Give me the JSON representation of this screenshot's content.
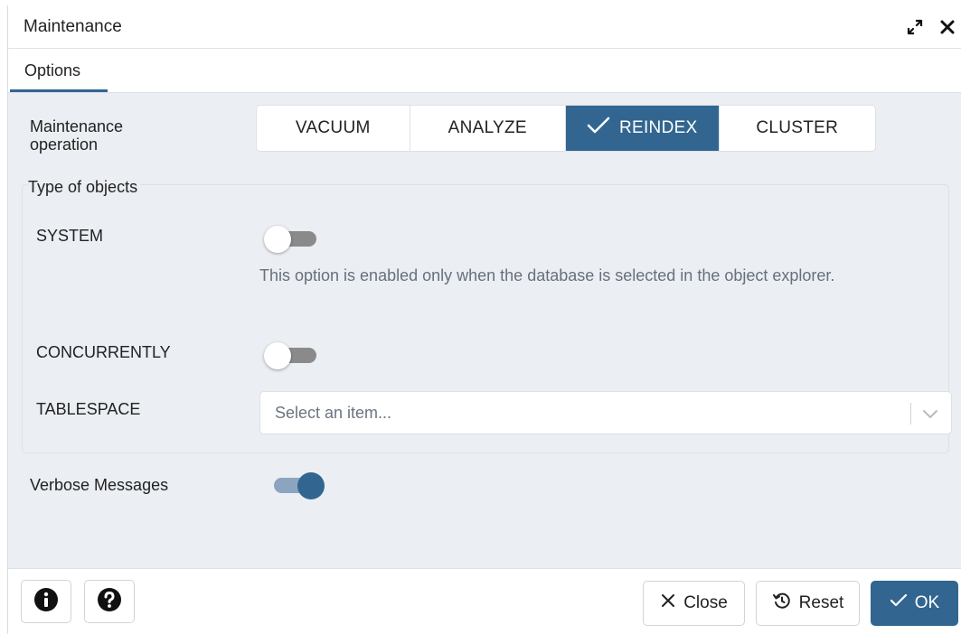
{
  "dialog": {
    "title": "Maintenance",
    "expand_icon": "expand-arrows-icon",
    "close_icon": "close-icon"
  },
  "tabs": [
    {
      "label": "Options",
      "active": true
    }
  ],
  "operation": {
    "label": "Maintenance operation",
    "options": [
      "VACUUM",
      "ANALYZE",
      "REINDEX",
      "CLUSTER"
    ],
    "selected": "REINDEX"
  },
  "objects": {
    "legend": "Type of objects",
    "system": {
      "label": "SYSTEM",
      "enabled": false,
      "help": "This option is enabled only when the database is selected in the object explorer."
    },
    "concurrently": {
      "label": "CONCURRENTLY",
      "enabled": false
    },
    "tablespace": {
      "label": "TABLESPACE",
      "placeholder": "Select an item..."
    }
  },
  "verbose": {
    "label": "Verbose Messages",
    "enabled": true
  },
  "footer": {
    "info_icon": "info-icon",
    "help_icon": "help-icon",
    "close_label": "Close",
    "reset_label": "Reset",
    "ok_label": "OK"
  },
  "colors": {
    "primary": "#326690",
    "body_bg": "#ebeef3",
    "toggle_off": "#8a8a8a",
    "muted_text": "#67707b"
  }
}
